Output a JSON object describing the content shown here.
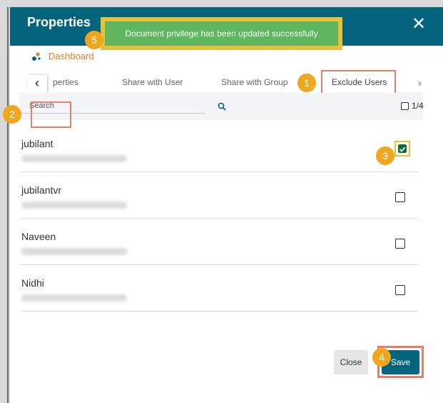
{
  "dialog": {
    "title": "Properties",
    "close_icon": "close-icon",
    "close_glyph": "✕"
  },
  "toast": {
    "message": "Document privilege has been updated successfully",
    "color": "#5fb65f"
  },
  "breadcrumb": {
    "icon": "dashboard-icon",
    "label": "Dashboard",
    "color": "#e0822c"
  },
  "tabs": {
    "left_arrow": "‹",
    "right_arrow": "›",
    "items": [
      {
        "label": "perties",
        "active": false
      },
      {
        "label": "Share with User",
        "active": false
      },
      {
        "label": "Share with Group",
        "active": false
      },
      {
        "label": "Exclude Users",
        "active": true
      }
    ]
  },
  "search": {
    "placeholder": "Search",
    "value": "",
    "icon": "search-icon",
    "select_all_count": "1/4"
  },
  "users": [
    {
      "name": "jubilant",
      "checked": true
    },
    {
      "name": "jubilantvr",
      "checked": false
    },
    {
      "name": "Naveen",
      "checked": false
    },
    {
      "name": "Nidhi",
      "checked": false
    }
  ],
  "buttons": {
    "close_label": "Close",
    "save_label": "Save"
  },
  "badges": [
    "1",
    "2",
    "3",
    "4",
    "5"
  ],
  "colors": {
    "header": "#05647d",
    "accent_orange": "#f0a61e",
    "highlight_box": "#e0826a",
    "checked_green": "#0f6e35"
  }
}
